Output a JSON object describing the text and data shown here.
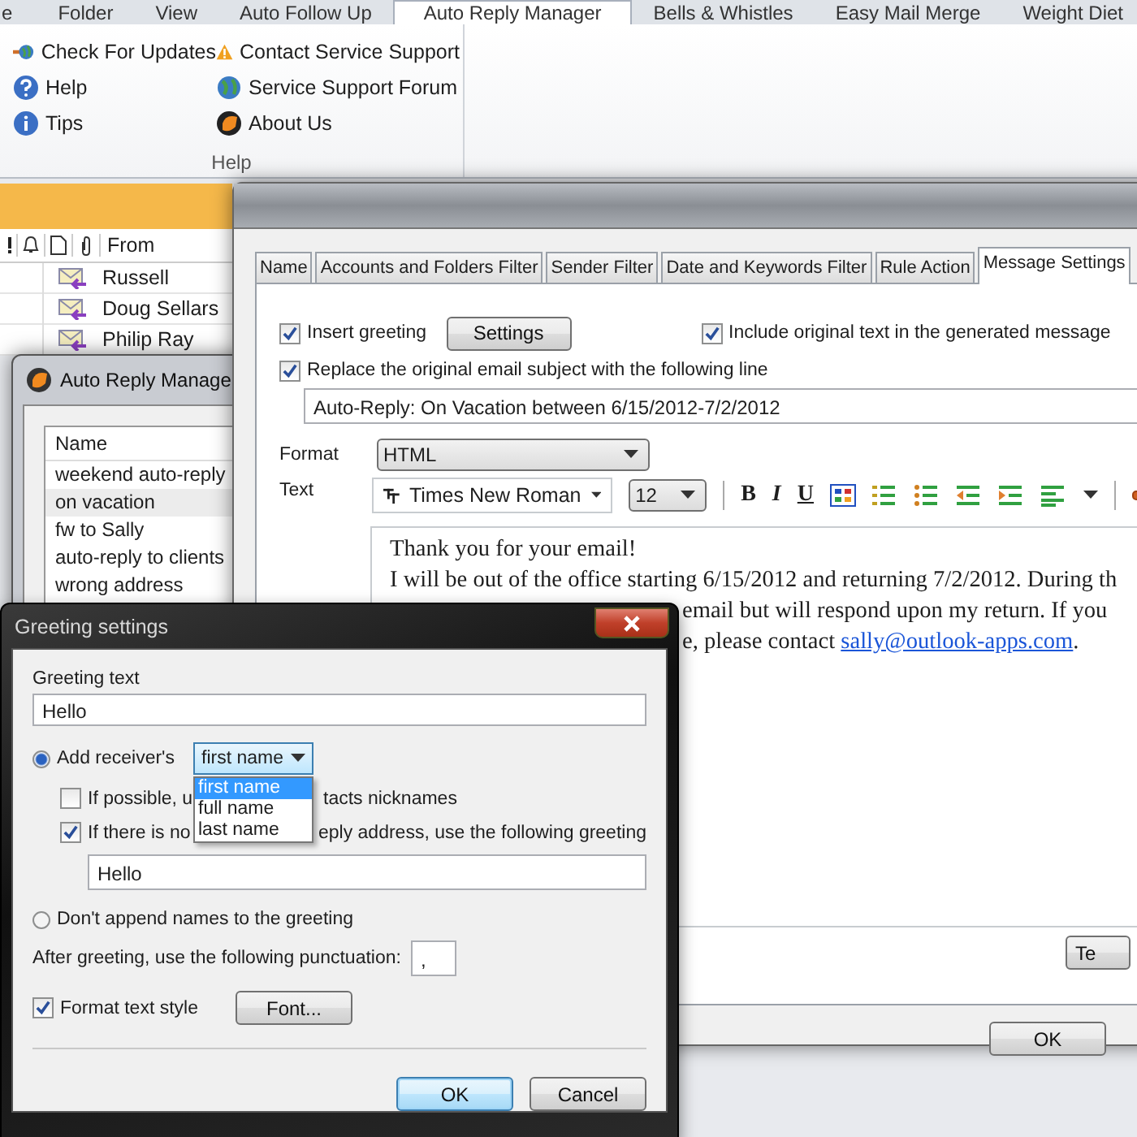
{
  "ribbon": {
    "tabs": [
      {
        "label": "e",
        "selected": false
      },
      {
        "label": "Folder",
        "selected": false
      },
      {
        "label": "View",
        "selected": false
      },
      {
        "label": "Auto Follow Up",
        "selected": false
      },
      {
        "label": "Auto Reply Manager",
        "selected": true
      },
      {
        "label": "Bells & Whistles",
        "selected": false
      },
      {
        "label": "Easy Mail Merge",
        "selected": false
      },
      {
        "label": "Weight Diet",
        "selected": false
      }
    ],
    "group": {
      "title": "Help",
      "items": [
        "Check For Updates",
        "Help",
        "Tips",
        "Contact Service Support",
        "Service Support Forum",
        "About Us"
      ]
    }
  },
  "mail_list": {
    "from_header": "From",
    "rows": [
      "Russell",
      "Doug Sellars",
      "Philip Ray"
    ]
  },
  "rule_window": {
    "title": "Auto Reply Manage",
    "column": "Name",
    "rows": [
      {
        "name": "weekend auto-reply",
        "selected": false
      },
      {
        "name": "on vacation",
        "selected": true
      },
      {
        "name": "fw to Sally",
        "selected": false
      },
      {
        "name": "auto-reply to clients",
        "selected": false
      },
      {
        "name": "wrong address",
        "selected": false
      }
    ]
  },
  "rule_dialog": {
    "tabs": [
      {
        "label": "Name",
        "selected": false
      },
      {
        "label": "Accounts and Folders Filter",
        "selected": false
      },
      {
        "label": "Sender Filter",
        "selected": false
      },
      {
        "label": "Date and Keywords Filter",
        "selected": false
      },
      {
        "label": "Rule Action",
        "selected": false
      },
      {
        "label": "Message Settings",
        "selected": true
      }
    ],
    "insert_greeting": {
      "label": "Insert greeting",
      "checked": true
    },
    "settings_button": "Settings",
    "include_original": {
      "label": "Include original text in the generated message",
      "checked": true
    },
    "replace_subject": {
      "label": "Replace the original email subject with the following line",
      "checked": true
    },
    "subject": "Auto-Reply: On Vacation between 6/15/2012-7/2/2012",
    "format_label": "Format",
    "format": "HTML",
    "text_label": "Text",
    "font": "Times New Roman",
    "font_size": "12",
    "style_buttons": [
      "B",
      "I",
      "U"
    ],
    "body": [
      {
        "kind": "full",
        "text": "Thank you for your email!"
      },
      {
        "kind": "full",
        "text": "I will be out of the office starting 6/15/2012 and returning 7/2/2012. During th"
      },
      {
        "kind": "partial",
        "text": "email but will respond upon my return. If you"
      },
      {
        "kind": "partial",
        "text": "e, please contact ",
        "link": "sally@outlook-apps.com",
        "after": "."
      }
    ],
    "side_button": "Te",
    "ok_button": "OK"
  },
  "greeting_dialog": {
    "title": "Greeting settings",
    "greeting_label": "Greeting text",
    "greeting": "Hello",
    "add_receiver": {
      "label": "Add receiver's",
      "selected": true
    },
    "name_select": "first name",
    "name_options": [
      {
        "label": "first name",
        "selected": true
      },
      {
        "label": "full name",
        "selected": false
      },
      {
        "label": "last name",
        "selected": false
      }
    ],
    "nicknames": {
      "checked": false,
      "visible_start": "If possible, u",
      "visible_end": "tacts nicknames"
    },
    "no_name": {
      "checked": true,
      "visible_start": "If there is no",
      "visible_end": "eply address, use the following greeting"
    },
    "fallback_greeting": "Hello",
    "dont_append": {
      "label": "Don't append names to the greeting",
      "selected": false
    },
    "punctuation_label": "After greeting, use the following punctuation:",
    "punctuation": ",",
    "format_style": {
      "label": "Format text style",
      "checked": true
    },
    "font_button": "Font...",
    "ok_button": "OK",
    "cancel_button": "Cancel"
  }
}
